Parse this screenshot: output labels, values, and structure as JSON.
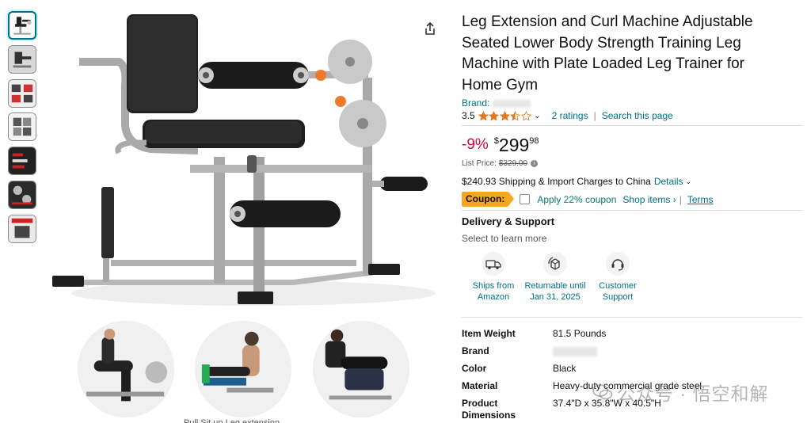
{
  "product": {
    "title": "Leg Extension and Curl Machine Adjustable Seated Lower Body Strength Training Leg Machine with Plate Loaded Leg Trainer for Home Gym",
    "brand_label": "Brand:",
    "rating_value": "3.5",
    "rating_stars": 3.5,
    "ratings_count": "2 ratings",
    "search_link": "Search this page"
  },
  "price": {
    "discount": "-9%",
    "currency": "$",
    "whole": "299",
    "fraction": "98",
    "list_label": "List Price:",
    "list_value": "$329.00"
  },
  "shipping": {
    "text": "$240.93 Shipping & Import Charges to China",
    "details_link": "Details"
  },
  "coupon": {
    "badge": "Coupon:",
    "apply_text": "Apply 22% coupon",
    "shop_items": "Shop items ›",
    "terms": "Terms"
  },
  "delivery": {
    "heading": "Delivery & Support",
    "subheading": "Select to learn more",
    "features": [
      {
        "line1": "Ships from",
        "line2": "Amazon",
        "icon": "truck-icon"
      },
      {
        "line1": "Returnable until",
        "line2": "Jan 31, 2025",
        "icon": "return-box-icon"
      },
      {
        "line1": "Customer",
        "line2": "Support",
        "icon": "headset-icon"
      }
    ]
  },
  "specs": [
    {
      "key": "Item Weight",
      "value": "81.5 Pounds"
    },
    {
      "key": "Brand",
      "value": ""
    },
    {
      "key": "Color",
      "value": "Black"
    },
    {
      "key": "Material",
      "value": "Heavy-duty commercial grade steel"
    },
    {
      "key": "Product Dimensions",
      "value": "37.4\"D x 35.8\"W x 40.5\"H"
    }
  ],
  "watermark": "公众号 · 悟空和解",
  "colors": {
    "link": "#007185",
    "discount": "#cc0c39",
    "coupon_badge": "#f7a624",
    "coupon_text": "#067d62",
    "star": "#de7921"
  }
}
